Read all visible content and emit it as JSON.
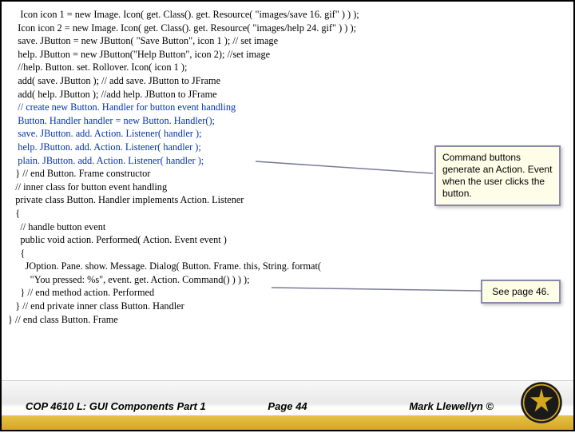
{
  "code": {
    "l1": "     Icon icon 1 = new Image. Icon( get. Class(). get. Resource( \"images/save 16. gif\" ) ) );",
    "l2": "    Icon icon 2 = new Image. Icon( get. Class(). get. Resource( \"images/help 24. gif\" ) ) );",
    "l3": "    save. JButton = new JButton( \"Save Button\", icon 1 ); // set image",
    "l4": "    help. JButton = new JButton(\"Help Button\", icon 2); //set image",
    "l5": "    //help. Button. set. Rollover. Icon( icon 1 );",
    "l6": "    add( save. JButton ); // add save. JButton to JFrame",
    "l7": "    add( help. JButton ); //add help. JButton to JFrame",
    "l8": "",
    "l9": "    // create new Button. Handler for button event handling",
    "l10": "    Button. Handler handler = new Button. Handler();",
    "l11": "    save. JButton. add. Action. Listener( handler );",
    "l12": "    help. JButton. add. Action. Listener( handler );",
    "l13": "    plain. JButton. add. Action. Listener( handler );",
    "l14": "   } // end Button. Frame constructor",
    "l15": "",
    "l16": "   // inner class for button event handling",
    "l17": "   private class Button. Handler implements Action. Listener",
    "l18": "   {",
    "l19": "     // handle button event",
    "l20": "     public void action. Performed( Action. Event event )",
    "l21": "     {",
    "l22": "       JOption. Pane. show. Message. Dialog( Button. Frame. this, String. format(",
    "l23": "         \"You pressed: %s\", event. get. Action. Command() ) ) );",
    "l24": "     } // end method action. Performed",
    "l25": "   } // end private inner class Button. Handler",
    "l26": "} // end class Button. Frame"
  },
  "callout1": "Command buttons generate an Action. Event when the user clicks the button.",
  "callout2": "See page 46.",
  "footer": {
    "left": "COP 4610 L: GUI Components Part 1",
    "center": "Page 44",
    "right": "Mark Llewellyn ©"
  }
}
